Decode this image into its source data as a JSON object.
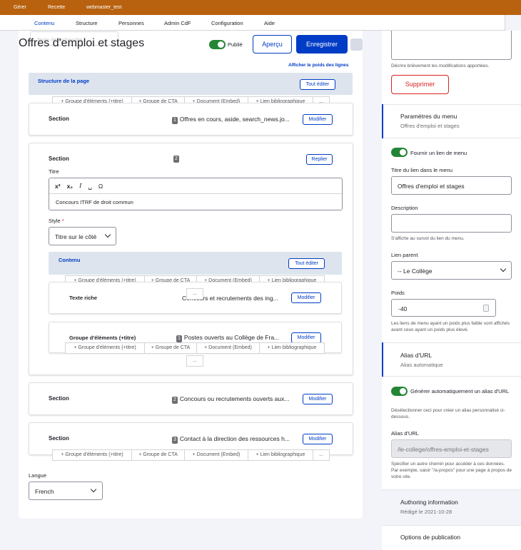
{
  "toolbar": {
    "manage": "Gérer",
    "shortcuts": "Recette",
    "user": "webmaster_test"
  },
  "tabs": [
    "Contenu",
    "Structure",
    "Personnes",
    "Admin CdF",
    "Configuration",
    "Aide"
  ],
  "search_placeholder": "Texte de recherche...",
  "page_title": "Offres d'emploi et stages",
  "published_label": "Publié",
  "preview_label": "Aperçu",
  "save_label": "Enregistrer",
  "show_weights": "Afficher le poids des lignes",
  "structure_title": "Structure de la page",
  "edit_all": "Tout éditer",
  "add_types": [
    "+ Groupe d'éléments (+titre)",
    "+ Groupe de CTA",
    "+ Document (Embed)",
    "+ Lien bibliographique"
  ],
  "more": "...",
  "modify": "Modifier",
  "collapse": "Replier",
  "sections": [
    {
      "label": "Section",
      "num": "1",
      "summary": "Offres en cours, aside, search_news.jo..."
    },
    {
      "label": "Section",
      "num": "2"
    },
    {
      "label": "Section",
      "num": "2",
      "summary": "Concours ou recrutements ouverts aux..."
    },
    {
      "label": "Section",
      "num": "3",
      "summary": "Contact à la direction des ressources h..."
    }
  ],
  "title_field": {
    "label": "Titre",
    "value": "Concours ITRF de droit commun",
    "tools": [
      "x²",
      "x₂",
      "I",
      "␣",
      "Ω"
    ]
  },
  "style_field": {
    "label": "Style",
    "required": "*",
    "value": "Titre sur le côté"
  },
  "content_title": "Contenu",
  "rich_text": {
    "label": "Texte riche",
    "summary": "Concours et recrutements des ing..."
  },
  "group": {
    "label": "Groupe d'éléments (+titre)",
    "num": "1",
    "summary": "Postes ouverts au Collège de Fra..."
  },
  "language": {
    "label": "Langue",
    "value": "French"
  },
  "sidebar": {
    "revision_help": "Décrire brièvement les modifications apportées.",
    "delete_label": "Supprimer",
    "menu_settings": {
      "title": "Paramètres du menu",
      "subtitle": "Offres d'emploi et stages"
    },
    "provide_menu_link": "Fournir un lien de menu",
    "menu_link_title": {
      "label": "Titre du lien dans le menu",
      "value": "Offres d'emploi et stages"
    },
    "description": {
      "label": "Description",
      "help": "S'affiche au survol du lien du menu."
    },
    "parent_link": {
      "label": "Lien parent",
      "value": "-- Le Collège"
    },
    "weight": {
      "label": "Poids",
      "value": "-40",
      "help": "Les liens de menu ayant un poids plus faible sont affichés avant ceux ayant un poids plus élevé."
    },
    "url_alias": {
      "title": "Alias d'URL",
      "subtitle": "Alias automatique"
    },
    "auto_alias": "Générer automatiquement un alias d'URL",
    "auto_alias_help": "Désélectionner ceci pour créer un alias personnalisé ci-dessous.",
    "alias": {
      "label": "Alias d'URL",
      "value": "/le-college/offres-emploi-et-stages",
      "help": "Spécifier un autre chemin pour accéder à ces données. Par exemple, saisir \"/a-propos\" pour une page à propos de votre site."
    },
    "authoring": {
      "title": "Authoring information",
      "subtitle": "Rédigé le 2021-10-28"
    },
    "publishing": {
      "title": "Options de publication"
    }
  },
  "colors": {
    "toolbar": "#b8610f",
    "accent": "#003cc5",
    "toggle_on": "#238636",
    "danger": "#d72222",
    "band": "#dde4ee"
  }
}
